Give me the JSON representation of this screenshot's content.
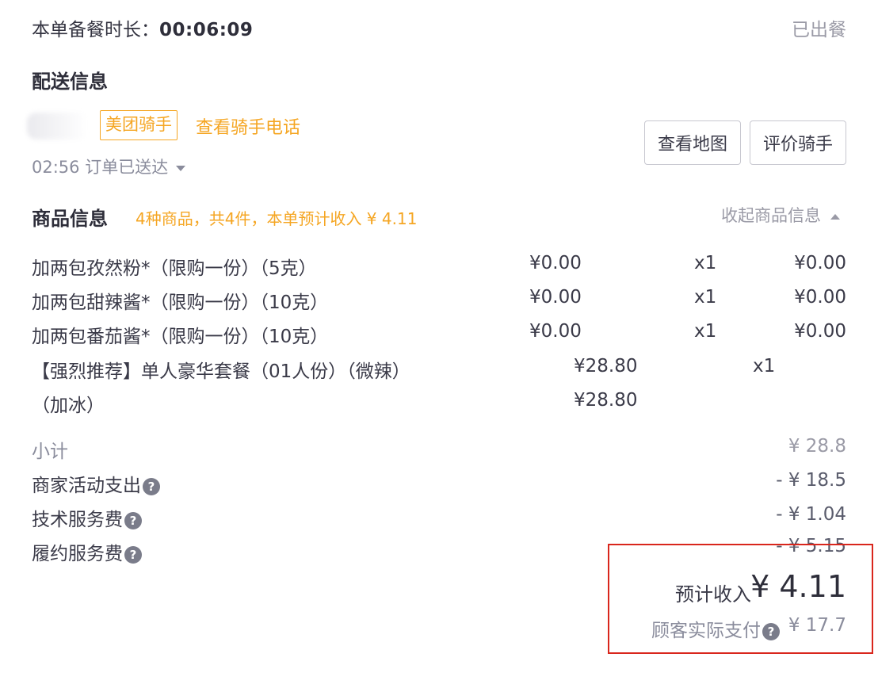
{
  "header": {
    "prep_label": "本单备餐时长：",
    "prep_time": "00:06:09",
    "status": "已出餐"
  },
  "delivery": {
    "title": "配送信息",
    "rider_badge": "美团骑手",
    "rider_phone_link": "查看骑手电话",
    "delivered_text": "02:56 订单已送达",
    "map_button": "查看地图",
    "rate_button": "评价骑手"
  },
  "goods": {
    "title": "商品信息",
    "summary": "4种商品，共4件，本单预计收入 ¥ 4.11",
    "collapse_label": "收起商品信息",
    "items": [
      {
        "name": "加两包孜然粉*（限购一份）（5克）",
        "price": "¥0.00",
        "qty": "x1",
        "total": "¥0.00"
      },
      {
        "name": "加两包甜辣酱*（限购一份）（10克）",
        "price": "¥0.00",
        "qty": "x1",
        "total": "¥0.00"
      },
      {
        "name": "加两包番茄酱*（限购一份）（10克）",
        "price": "¥0.00",
        "qty": "x1",
        "total": "¥0.00"
      },
      {
        "name": "【强烈推荐】单人豪华套餐（01人份）（微辣）",
        "name_line2": "（加冰）",
        "price": "¥28.80",
        "qty": "x1",
        "total": "¥28.80"
      }
    ]
  },
  "fees": {
    "subtotal_label": "小计",
    "subtotal_value": "¥ 28.8",
    "merchant_activity_label": "商家活动支出",
    "merchant_activity_value": "- ¥ 18.5",
    "tech_service_label": "技术服务费",
    "tech_service_value": "- ¥ 1.04",
    "fulfillment_label": "履约服务费",
    "fulfillment_value": "- ¥ 5.15"
  },
  "summary": {
    "income_label": "预计收入",
    "income_value": "¥ 4.11",
    "paid_label": "顾客实际支付",
    "paid_value": "¥ 17.7"
  },
  "icons": {
    "help": "?"
  },
  "colors": {
    "accent_orange": "#f5a623",
    "highlight_red": "#d9261c",
    "muted_text": "#8a8c9c"
  }
}
